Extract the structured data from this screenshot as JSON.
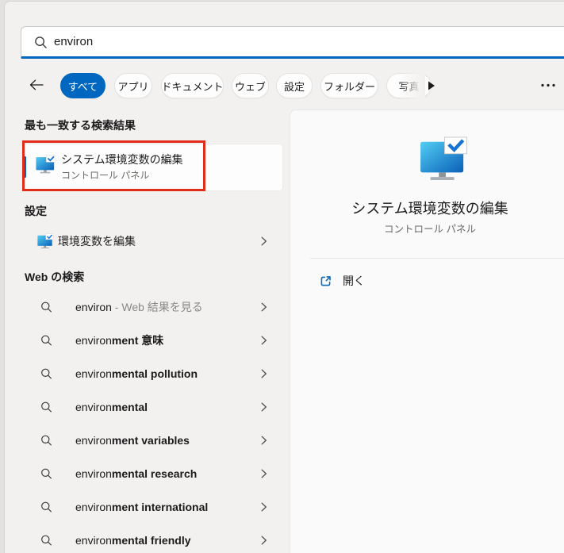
{
  "search": {
    "value": "environ"
  },
  "tabs": {
    "items": [
      {
        "label": "すべて",
        "active": true
      },
      {
        "label": "アプリ",
        "active": false
      },
      {
        "label": "ドキュメント",
        "active": false
      },
      {
        "label": "ウェブ",
        "active": false
      },
      {
        "label": "設定",
        "active": false
      },
      {
        "label": "フォルダー",
        "active": false
      },
      {
        "label": "写真",
        "active": false
      }
    ]
  },
  "sections": {
    "best_match": "最も一致する検索結果",
    "settings": "設定",
    "web": "Web の検索"
  },
  "best_match": {
    "title": "システム環境変数の編集",
    "subtitle": "コントロール パネル"
  },
  "settings_items": [
    {
      "label": "環境変数を編集"
    }
  ],
  "web_suggestions": [
    {
      "query": "environ",
      "suffix": " - Web 結果を見る"
    },
    {
      "query": "environ",
      "suffix": "ment 意味"
    },
    {
      "query": "environ",
      "suffix": "mental pollution"
    },
    {
      "query": "environ",
      "suffix": "mental"
    },
    {
      "query": "environ",
      "suffix": "ment variables"
    },
    {
      "query": "environ",
      "suffix": "mental research"
    },
    {
      "query": "environ",
      "suffix": "ment international"
    },
    {
      "query": "environ",
      "suffix": "mental friendly"
    }
  ],
  "preview": {
    "title": "システム環境変数の編集",
    "subtitle": "コントロール パネル",
    "open_label": "開く"
  },
  "colors": {
    "accent": "#0067c0",
    "annotation_red": "#e12b1b",
    "icon_blue_light": "#53cdf3",
    "icon_blue_dark": "#0a60b8"
  }
}
